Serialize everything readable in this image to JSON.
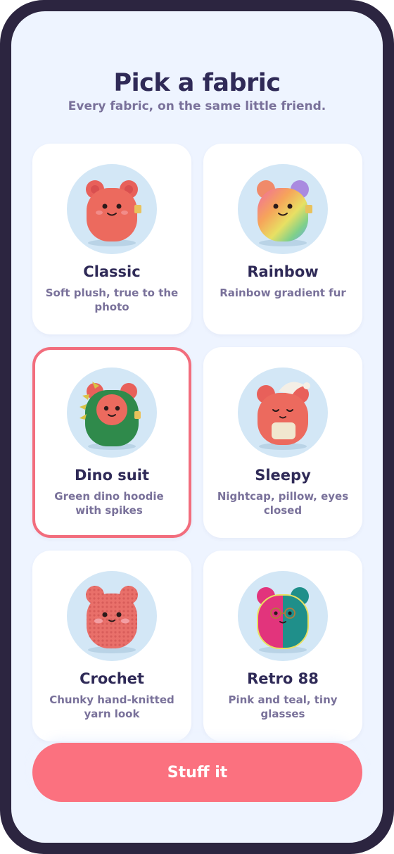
{
  "header": {
    "title": "Pick a fabric",
    "subtitle": "Every fabric, on the same little friend."
  },
  "fabrics": [
    {
      "name": "Classic",
      "description": "Soft plush, true to the photo",
      "icon": "plush-classic-icon",
      "selected": false
    },
    {
      "name": "Rainbow",
      "description": "Rainbow gradient fur",
      "icon": "plush-rainbow-icon",
      "selected": false
    },
    {
      "name": "Dino suit",
      "description": "Green dino hoodie with spikes",
      "icon": "plush-dino-icon",
      "selected": true
    },
    {
      "name": "Sleepy",
      "description": "Nightcap, pillow, eyes closed",
      "icon": "plush-sleepy-icon",
      "selected": false
    },
    {
      "name": "Crochet",
      "description": "Chunky hand-knitted yarn look",
      "icon": "plush-crochet-icon",
      "selected": false
    },
    {
      "name": "Retro 88",
      "description": "Pink and teal, tiny glasses",
      "icon": "plush-retro-icon",
      "selected": false
    }
  ],
  "cta": {
    "label": "Stuff it"
  },
  "colors": {
    "frame": "#2c2540",
    "background": "#eef4ff",
    "accent": "#fb717f",
    "selected_border": "#f26d7d",
    "title": "#2f2a57",
    "muted": "#79719a"
  }
}
